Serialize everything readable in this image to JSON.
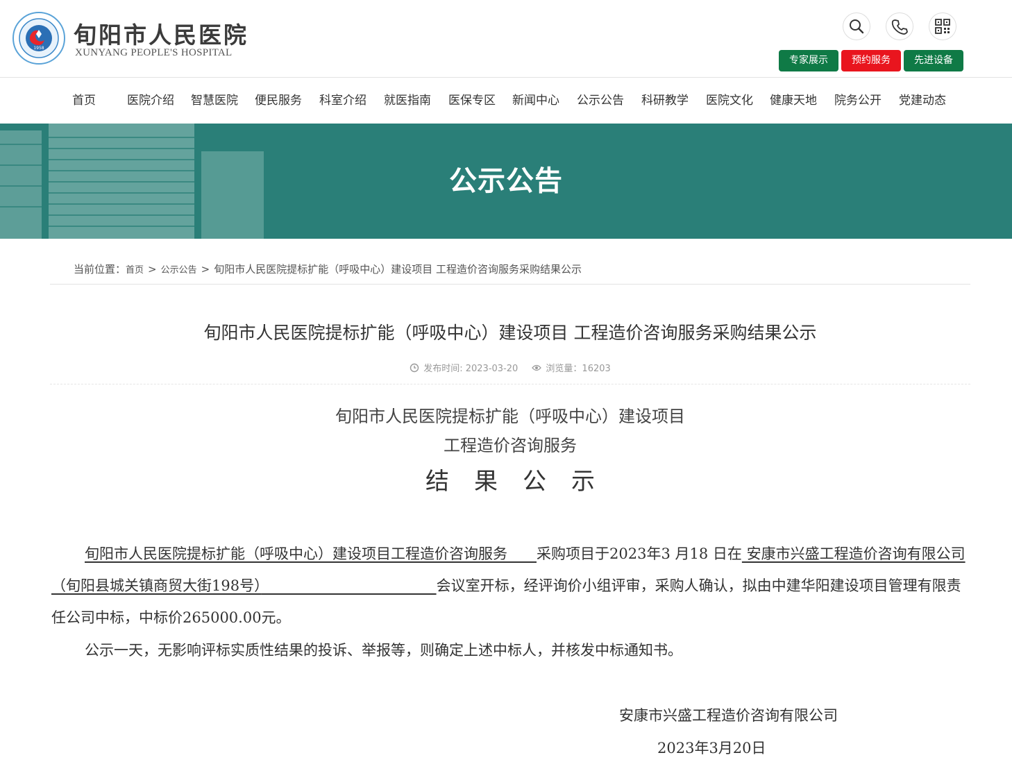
{
  "header": {
    "logo_cn": "旬阳市人民医院",
    "logo_en": "XUNYANG PEOPLE'S HOSPITAL",
    "icons": [
      "search-icon",
      "phone-icon",
      "qrcode-icon"
    ],
    "buttons": [
      {
        "label": "专家展示",
        "color": "#0f7a46"
      },
      {
        "label": "预约服务",
        "color": "#e9151e"
      },
      {
        "label": "先进设备",
        "color": "#0f7a46"
      }
    ]
  },
  "nav": {
    "items": [
      "首页",
      "医院介绍",
      "智慧医院",
      "便民服务",
      "科室介绍",
      "就医指南",
      "医保专区",
      "新闻中心",
      "公示公告",
      "科研教学",
      "医院文化",
      "健康天地",
      "院务公开",
      "党建动态"
    ]
  },
  "banner": {
    "title": "公示公告",
    "color": "#2a7f78"
  },
  "breadcrumb": {
    "prefix": "当前位置：",
    "home": "首页",
    "sep": ">",
    "section": "公示公告",
    "current": "旬阳市人民医院提标扩能（呼吸中心）建设项目 工程造价咨询服务采购结果公示"
  },
  "article": {
    "title": "旬阳市人民医院提标扩能（呼吸中心）建设项目 工程造价咨询服务采购结果公示",
    "publish_label": "发布时间: 2023-03-20",
    "views_label": "浏览量：16203"
  },
  "document": {
    "heading_line1": "旬阳市人民医院提标扩能（呼吸中心）建设项目",
    "heading_line2": "工程造价咨询服务",
    "heading_line3": "结果公示",
    "p1_project": "旬阳市人民医院提标扩能（呼吸中心）建设项目工程造价咨询服务",
    "p1_mid": "采购项目于2023年3  月18  日在",
    "p1_place": "  安康市兴盛工程造价咨询有限公司（旬阳县城关镇商贸大街198号）",
    "p1_end": "会议室开标，经评询价小组评审，采购人确认，拟由中建华阳建设项目管理有限责任公司中标，中标价265000.00元。",
    "p2": "公示一天，无影响评标实质性结果的投诉、举报等，则确定上述中标人，并核发中标通知书。",
    "signature_org": "安康市兴盛工程造价咨询有限公司",
    "signature_date": "2023年3月20日"
  }
}
